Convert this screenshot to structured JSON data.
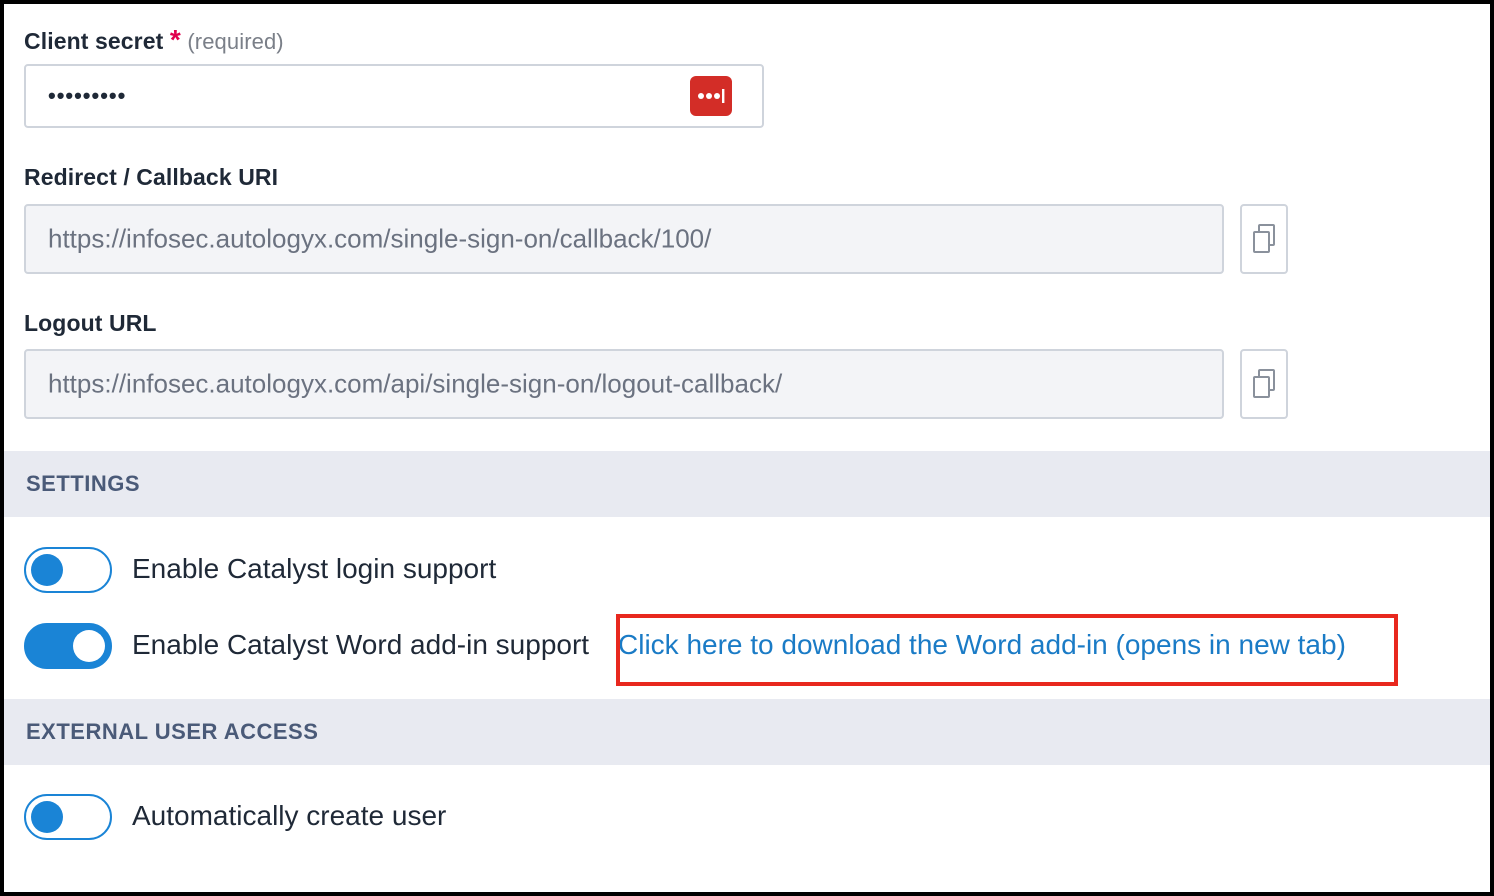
{
  "client_secret": {
    "label": "Client secret",
    "required_mark": "*",
    "required_text": "(required)",
    "value_masked": "•••••••••",
    "password_manager_icon": "lastpass-icon"
  },
  "redirect_uri": {
    "label": "Redirect / Callback URI",
    "value": "https://infosec.autologyx.com/single-sign-on/callback/100/",
    "copy_icon": "copy-icon"
  },
  "logout_url": {
    "label": "Logout URL",
    "value": "https://infosec.autologyx.com/api/single-sign-on/logout-callback/",
    "copy_icon": "copy-icon"
  },
  "settings": {
    "title": "SETTINGS",
    "toggles": [
      {
        "label": "Enable Catalyst login support",
        "on": false
      },
      {
        "label": "Enable Catalyst Word add-in support",
        "on": true,
        "link": "Click here to download the Word add-in (opens in new tab)"
      }
    ]
  },
  "external_user_access": {
    "title": "EXTERNAL USER ACCESS",
    "toggles": [
      {
        "label": "Automatically create user",
        "on": false
      }
    ]
  },
  "colors": {
    "accent": "#1a84d6",
    "link": "#1a7bc6",
    "required": "#e0004d",
    "section_bg": "#e8eaf1",
    "highlight": "#e8281e"
  }
}
